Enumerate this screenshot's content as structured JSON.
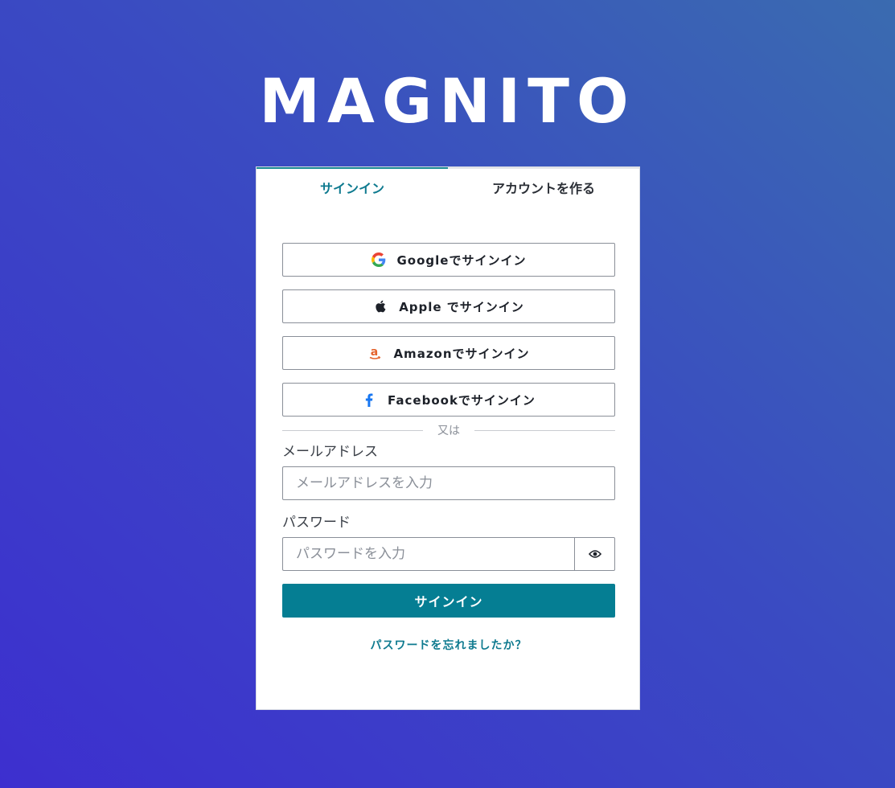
{
  "app": {
    "logo_text": "MAGNITO"
  },
  "tabs": [
    {
      "label": "サインイン",
      "active": true
    },
    {
      "label": "アカウントを作る",
      "active": false
    }
  ],
  "social_buttons": {
    "google": {
      "label": "Googleでサインイン",
      "icon": "google-icon"
    },
    "apple": {
      "label": "Apple でサインイン",
      "icon": "apple-icon"
    },
    "amazon": {
      "label": "Amazonでサインイン",
      "icon": "amazon-icon"
    },
    "facebook": {
      "label": "Facebookでサインイン",
      "icon": "facebook-icon"
    }
  },
  "divider_text": "又は",
  "email": {
    "label": "メールアドレス",
    "placeholder": "メールアドレスを入力",
    "value": ""
  },
  "password": {
    "label": "パスワード",
    "placeholder": "パスワードを入力",
    "value": "",
    "toggle_icon": "eye-icon"
  },
  "submit_label": "サインイン",
  "forgot_label": "パスワードを忘れましたか？",
  "colors": {
    "accent": "#057e93",
    "tab_active_text": "#0e7a8f",
    "background_start": "#3d2fcf",
    "background_end": "#3a6bb0"
  }
}
